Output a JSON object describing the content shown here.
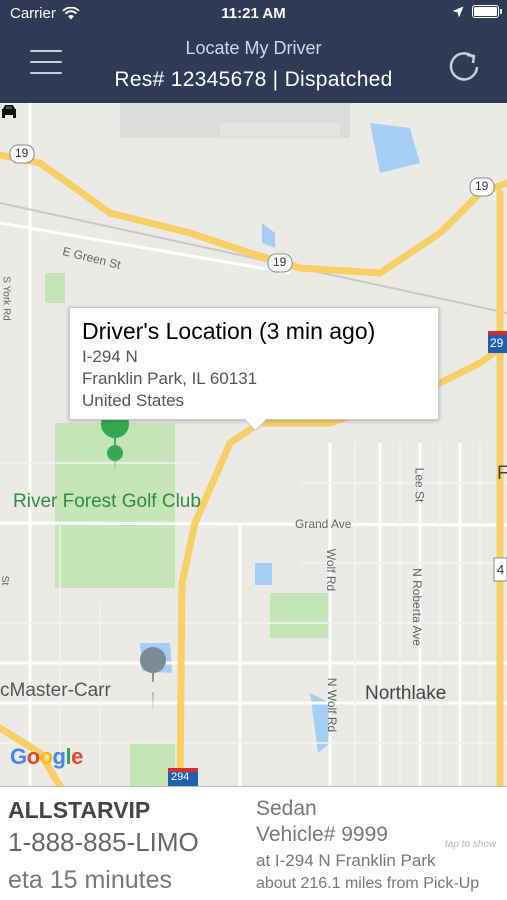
{
  "status_bar": {
    "carrier": "Carrier",
    "time": "11:21 AM",
    "icons": [
      "wifi-icon",
      "location-arrow-icon",
      "battery-icon"
    ]
  },
  "header": {
    "subtitle": "Locate My Driver",
    "title": "Res# 12345678 | Dispatched",
    "menu_icon": "hamburger-menu-icon",
    "refresh_icon": "refresh-icon",
    "background": "#2d3b55"
  },
  "map": {
    "callout": {
      "title": "Driver's Location (3 min ago)",
      "line1": "I-294 N",
      "line2": "Franklin Park, IL  60131",
      "line3": "United States"
    },
    "labels": {
      "green_st": "E Green St",
      "golf_club": "River Forest Golf Club",
      "grand_ave": "Grand Ave",
      "wolf_rd": "Wolf Rd",
      "lee_st": "Lee St",
      "roberta_ave": "N Roberta Ave",
      "n_wolf_rd": "N Wolf Rd",
      "northlake": "Northlake",
      "mcmaster": "cMaster-Carr",
      "york_rd": "S York Rd",
      "st_left": "St",
      "route_19a": "19",
      "route_19b": "19",
      "route_19c": "19",
      "i294_top": "29",
      "i294_bottom": "294",
      "us_4": "4",
      "f_edge": "F"
    },
    "google_logo": "Google",
    "road_color": "#f6cf65",
    "water_color": "#a6cef5",
    "park_color": "#c6e5b6"
  },
  "info": {
    "company": "ALLSTARVIP",
    "phone": "1-888-885-LIMO",
    "eta": "eta 15 minutes",
    "vehicle_type": "Sedan",
    "vehicle_number": "Vehicle# 9999",
    "location": "at I-294 N Franklin Park",
    "distance": "about 216.1 miles from Pick-Up",
    "hint": "tap to show"
  }
}
